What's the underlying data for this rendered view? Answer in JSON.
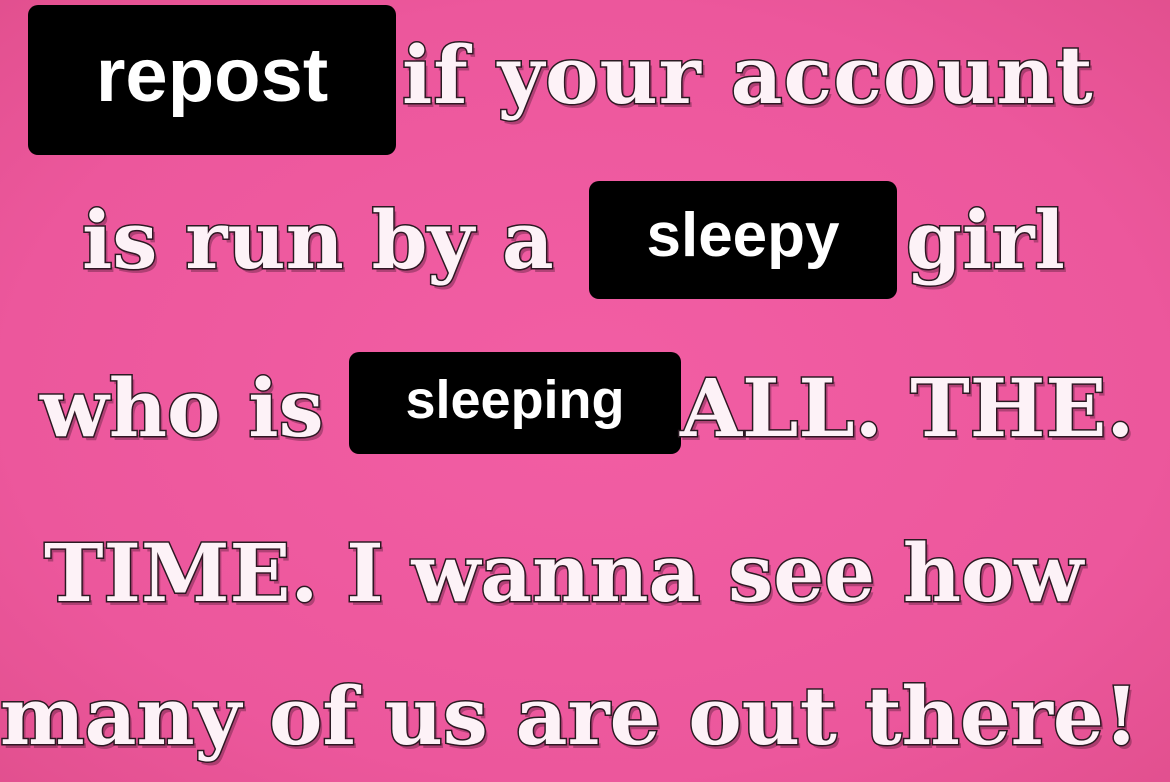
{
  "tags": {
    "repost": "repost",
    "sleepy": "sleepy",
    "sleeping": "sleeping"
  },
  "lines": {
    "l1": "if your account",
    "l2a": "is run by a",
    "l2b": "girl",
    "l3a": "who is",
    "l3b": "ALL. THE.",
    "l4": "TIME. I wanna see how",
    "l5": "many of us are out there!"
  },
  "colors": {
    "background": "#ef5aa0",
    "tag_background": "#000000",
    "tag_text": "#ffffff",
    "outline_text_fill": "#fdf2f7",
    "outline_text_stroke": "#2a1a22"
  }
}
